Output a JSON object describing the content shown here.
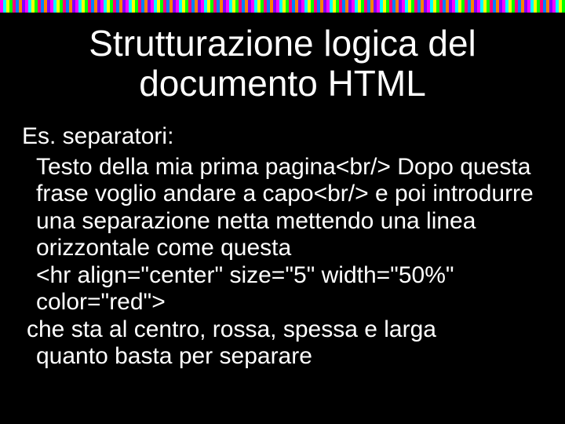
{
  "title": "Strutturazione logica del documento HTML",
  "intro": "Es. separatori:",
  "para1": "Testo della mia prima pagina<br/> Dopo questa frase voglio andare a capo<br/> e poi introdurre una separazione netta mettendo una linea orizzontale come questa",
  "code": "<hr align=\"center\" size=\"5\" width=\"50%\" color=\"red\">",
  "closing1": "che sta al centro, rossa, spessa e larga",
  "closing2": "quanto basta per separare"
}
